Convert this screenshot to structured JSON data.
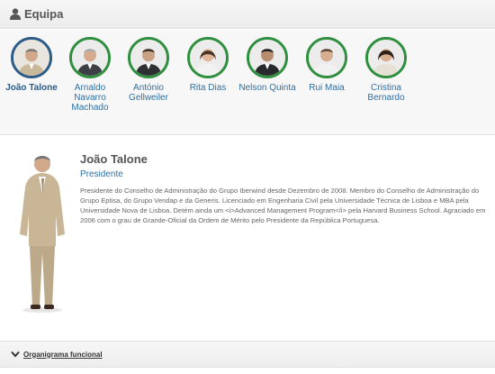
{
  "header": {
    "title": "Equipa",
    "icon": "user-icon"
  },
  "team": [
    {
      "name": "João Talone",
      "active": true
    },
    {
      "name": "Arnaldo Navarro Machado",
      "active": false
    },
    {
      "name": "António Gellweiler",
      "active": false
    },
    {
      "name": "Rita Dias",
      "active": false
    },
    {
      "name": "Nelson Quinta",
      "active": false
    },
    {
      "name": "Rui Maia",
      "active": false
    },
    {
      "name": "Cristina Bernardo",
      "active": false
    }
  ],
  "profile": {
    "name": "João Talone",
    "role": "Presidente",
    "bio": "Presidente do Conselho de Administração do Grupo Iberwind desde Dezembro de 2008. Membro do Conselho de Administração do Grupo Eptisa, do Grupo Vendap e da Generis. Licenciado em Engenharia Civil pela Universidade Técnica de Lisboa e MBA pela Universidade Nova de Lisboa. Detém ainda um <i>Advanced Management Program</i> pela Harvard Business School. Agraciado em 2006 com o grau de Grande-Oficial da Ordem de Mérito pelo Presidente da República Portuguesa."
  },
  "org_bar": {
    "label": "Organigrama funcional",
    "icon": "chevron-down-icon"
  },
  "colors": {
    "active_ring": "#2c5b86",
    "ring": "#2f8f3e",
    "link": "#2e6fa3"
  }
}
